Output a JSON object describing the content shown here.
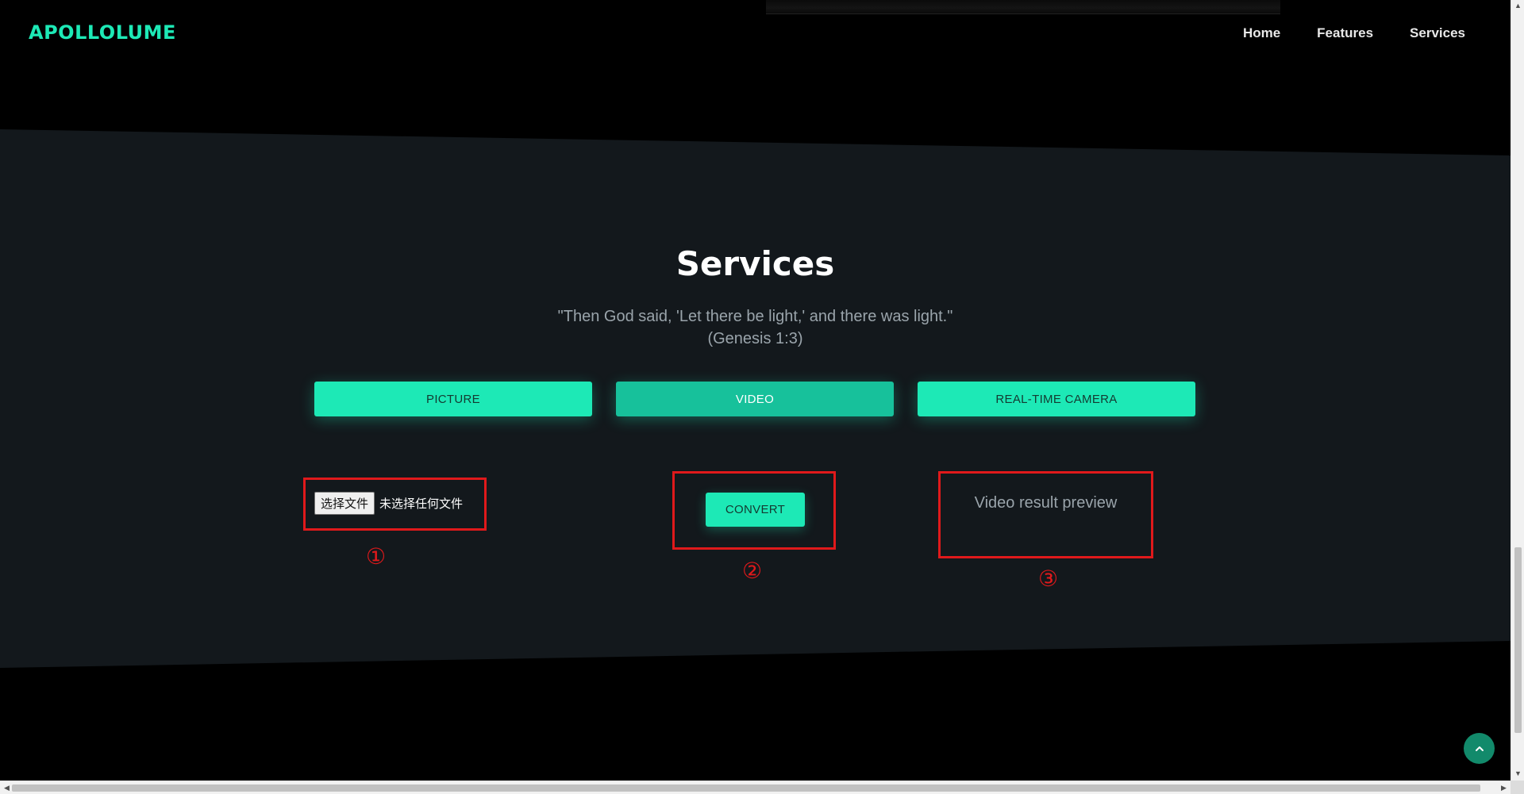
{
  "header": {
    "logo": "APOLLOLUME",
    "nav": [
      {
        "label": "Home"
      },
      {
        "label": "Features"
      },
      {
        "label": "Services"
      }
    ]
  },
  "services": {
    "title": "Services",
    "quote_line1": "\"Then God said, 'Let there be light,' and there was light.\"",
    "quote_line2": "(Genesis 1:3)",
    "tabs": [
      {
        "label": "PICTURE"
      },
      {
        "label": "VIDEO",
        "active": true
      },
      {
        "label": "REAL-TIME CAMERA"
      }
    ],
    "file_input": {
      "button_label": "选择文件",
      "status": "未选择任何文件"
    },
    "convert_label": "CONVERT",
    "preview_text": "Video result preview"
  },
  "annotations": [
    "①",
    "②",
    "③"
  ],
  "colors": {
    "accent": "#1de9b6",
    "accent_active": "#17c19b",
    "section_bg": "#13181c",
    "annotation": "#e0191b"
  },
  "icons": {
    "scroll_top": "chevron-up-icon"
  }
}
